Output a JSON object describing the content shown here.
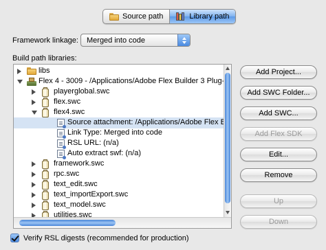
{
  "tabs": [
    {
      "label": "Source path",
      "icon": "folder-icon",
      "active": false
    },
    {
      "label": "Library path",
      "icon": "books-icon",
      "active": true
    }
  ],
  "linkage": {
    "label": "Framework linkage:",
    "value": "Merged into code"
  },
  "build_path": {
    "label": "Build path libraries:",
    "rows": [
      {
        "text": "libs",
        "icon": "folder-icon",
        "disclosure": "closed",
        "level": 0
      },
      {
        "text": "Flex 4 - 3009 - /Applications/Adobe Flex Builder 3 Plug-in",
        "icon": "library-icon",
        "disclosure": "open",
        "level": 0
      },
      {
        "text": "playerglobal.swc",
        "icon": "swc-icon",
        "disclosure": "closed",
        "level": 1
      },
      {
        "text": "flex.swc",
        "icon": "swc-icon",
        "disclosure": "closed",
        "level": 1
      },
      {
        "text": "flex4.swc",
        "icon": "swc-icon",
        "disclosure": "open",
        "level": 1
      },
      {
        "text": "Source attachment: /Applications/Adobe Flex Buil",
        "icon": "attribute-icon",
        "disclosure": "none",
        "level": 2,
        "selected": true
      },
      {
        "text": "Link Type: Merged into code",
        "icon": "attribute-icon",
        "disclosure": "none",
        "level": 2
      },
      {
        "text": "RSL URL: (n/a)",
        "icon": "attribute-icon",
        "disclosure": "none",
        "level": 2
      },
      {
        "text": "Auto extract swf: (n/a)",
        "icon": "attribute-icon",
        "disclosure": "none",
        "level": 2
      },
      {
        "text": "framework.swc",
        "icon": "swc-icon",
        "disclosure": "closed",
        "level": 1
      },
      {
        "text": "rpc.swc",
        "icon": "swc-icon",
        "disclosure": "closed",
        "level": 1
      },
      {
        "text": "text_edit.swc",
        "icon": "swc-icon",
        "disclosure": "closed",
        "level": 1
      },
      {
        "text": "text_importExport.swc",
        "icon": "swc-icon",
        "disclosure": "closed",
        "level": 1
      },
      {
        "text": "text_model.swc",
        "icon": "swc-icon",
        "disclosure": "closed",
        "level": 1
      },
      {
        "text": "utilities.swc",
        "icon": "swc-icon",
        "disclosure": "closed",
        "level": 1
      }
    ]
  },
  "buttons": [
    {
      "label": "Add Project...",
      "enabled": true
    },
    {
      "label": "Add SWC Folder...",
      "enabled": true
    },
    {
      "label": "Add SWC...",
      "enabled": true
    },
    {
      "label": "Add Flex SDK",
      "enabled": false
    },
    {
      "label": "Edit...",
      "enabled": true
    },
    {
      "label": "Remove",
      "enabled": true
    },
    {
      "label": "Up",
      "enabled": false
    },
    {
      "label": "Down",
      "enabled": false
    }
  ],
  "verify_rsl": {
    "label": "Verify RSL digests (recommended for production)",
    "checked": true
  },
  "colors": {
    "selection": "#d5e3f4",
    "accent": "#4a8ae0"
  }
}
